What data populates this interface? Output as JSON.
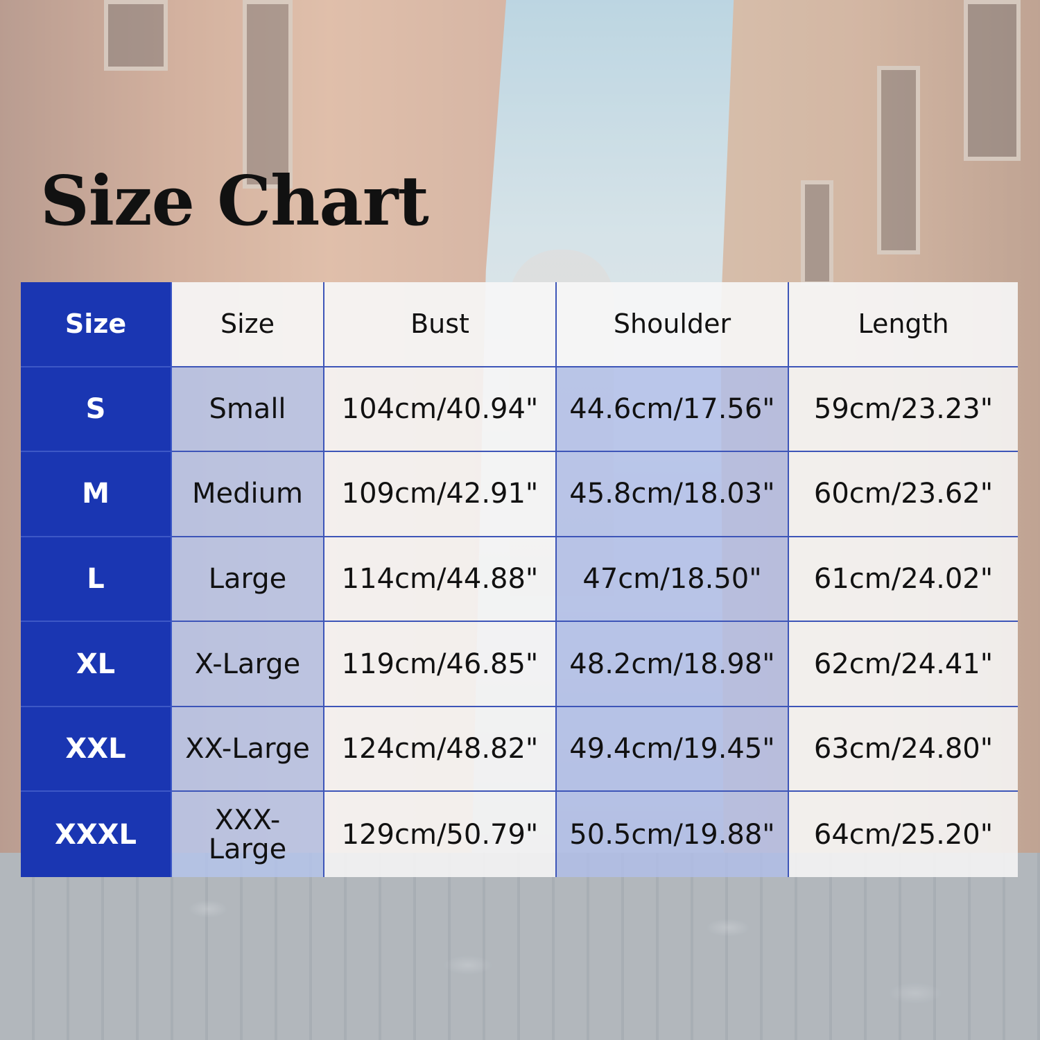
{
  "title": "Size Chart",
  "colors": {
    "code_column": "#1a36b2",
    "grid_lines": "#3d55b8",
    "light_cell": "#f6f6f6",
    "tinted_cell": "#b0beea"
  },
  "table": {
    "headers": [
      "Size",
      "Size",
      "Bust",
      "Shoulder",
      "Length"
    ],
    "rows": [
      {
        "code": "S",
        "name": "Small",
        "bust": "104cm/40.94\"",
        "shoulder": "44.6cm/17.56\"",
        "length": "59cm/23.23\""
      },
      {
        "code": "M",
        "name": "Medium",
        "bust": "109cm/42.91\"",
        "shoulder": "45.8cm/18.03\"",
        "length": "60cm/23.62\""
      },
      {
        "code": "L",
        "name": "Large",
        "bust": "114cm/44.88\"",
        "shoulder": "47cm/18.50\"",
        "length": "61cm/24.02\""
      },
      {
        "code": "XL",
        "name": "X-Large",
        "bust": "119cm/46.85\"",
        "shoulder": "48.2cm/18.98\"",
        "length": "62cm/24.41\""
      },
      {
        "code": "XXL",
        "name": "XX-Large",
        "bust": "124cm/48.82\"",
        "shoulder": "49.4cm/19.45\"",
        "length": "63cm/24.80\""
      },
      {
        "code": "XXXL",
        "name": "XXX-Large",
        "bust": "129cm/50.79\"",
        "shoulder": "50.5cm/19.88\"",
        "length": "64cm/25.20\""
      }
    ]
  }
}
